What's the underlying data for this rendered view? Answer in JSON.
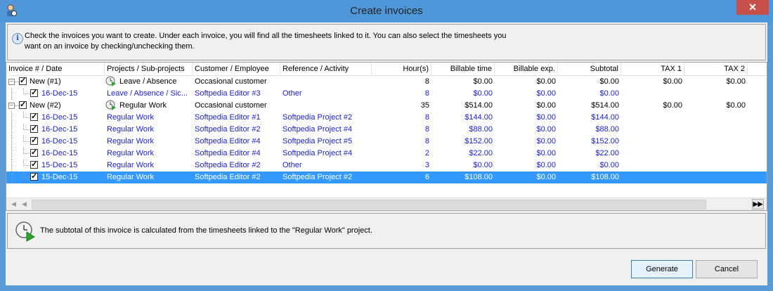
{
  "window": {
    "title": "Create invoices",
    "close_label": "✕"
  },
  "info": {
    "text_line1": "Check the invoices you want to create. Under each invoice, you will find all the timesheets linked to it. You can also select the timesheets you",
    "text_line2": "want on an invoice by checking/unchecking them."
  },
  "grid": {
    "columns": [
      "Invoice # / Date",
      "Projects / Sub-projects",
      "Customer / Employee",
      "Reference / Activity",
      "Hour(s)",
      "Billable time",
      "Billable exp.",
      "Subtotal",
      "TAX 1",
      "TAX 2"
    ],
    "rows": [
      {
        "level": 0,
        "date": "New (#1)",
        "project": "Leave / Absence",
        "customer": "Occasional customer",
        "reference": "",
        "hours": "8",
        "billable_time": "$0.00",
        "billable_exp": "$0.00",
        "subtotal": "$0.00",
        "tax1": "$0.00",
        "tax2": "$0.00"
      },
      {
        "level": 1,
        "date": "16-Dec-15",
        "project": "Leave / Absence / Sic...",
        "customer": "Softpedia Editor #3",
        "reference": "Other",
        "hours": "8",
        "billable_time": "$0.00",
        "billable_exp": "$0.00",
        "subtotal": "$0.00",
        "tax1": "",
        "tax2": ""
      },
      {
        "level": 0,
        "date": "New (#2)",
        "project": "Regular Work",
        "customer": "Occasional customer",
        "reference": "",
        "hours": "35",
        "billable_time": "$514.00",
        "billable_exp": "$0.00",
        "subtotal": "$514.00",
        "tax1": "$0.00",
        "tax2": "$0.00"
      },
      {
        "level": 1,
        "date": "16-Dec-15",
        "project": "Regular Work",
        "customer": "Softpedia Editor #1",
        "reference": "Softpedia Project #2",
        "hours": "8",
        "billable_time": "$144.00",
        "billable_exp": "$0.00",
        "subtotal": "$144.00",
        "tax1": "",
        "tax2": ""
      },
      {
        "level": 1,
        "date": "16-Dec-15",
        "project": "Regular Work",
        "customer": "Softpedia Editor #2",
        "reference": "Softpedia Project #4",
        "hours": "8",
        "billable_time": "$88.00",
        "billable_exp": "$0.00",
        "subtotal": "$88.00",
        "tax1": "",
        "tax2": ""
      },
      {
        "level": 1,
        "date": "16-Dec-15",
        "project": "Regular Work",
        "customer": "Softpedia Editor #4",
        "reference": "Softpedia Project #5",
        "hours": "8",
        "billable_time": "$152.00",
        "billable_exp": "$0.00",
        "subtotal": "$152.00",
        "tax1": "",
        "tax2": ""
      },
      {
        "level": 1,
        "date": "16-Dec-15",
        "project": "Regular Work",
        "customer": "Softpedia Editor #4",
        "reference": "Softpedia Project #4",
        "hours": "2",
        "billable_time": "$22.00",
        "billable_exp": "$0.00",
        "subtotal": "$22.00",
        "tax1": "",
        "tax2": ""
      },
      {
        "level": 1,
        "date": "15-Dec-15",
        "project": "Regular Work",
        "customer": "Softpedia Editor #2",
        "reference": "Other",
        "hours": "3",
        "billable_time": "$0.00",
        "billable_exp": "$0.00",
        "subtotal": "$0.00",
        "tax1": "",
        "tax2": ""
      },
      {
        "level": 1,
        "date": "15-Dec-15",
        "project": "Regular Work",
        "customer": "Softpedia Editor #2",
        "reference": "Softpedia Project #2",
        "hours": "6",
        "billable_time": "$108.00",
        "billable_exp": "$0.00",
        "subtotal": "$108.00",
        "tax1": "",
        "tax2": ""
      }
    ],
    "selected_row": 8
  },
  "note": {
    "text": "The subtotal of this invoice is calculated from the timesheets linked to the \"Regular Work\" project."
  },
  "buttons": {
    "generate": "Generate",
    "cancel": "Cancel"
  },
  "colors": {
    "title_bar": "#4f97d8",
    "selection": "#3399ff",
    "child_text": "#1c1ccc"
  }
}
